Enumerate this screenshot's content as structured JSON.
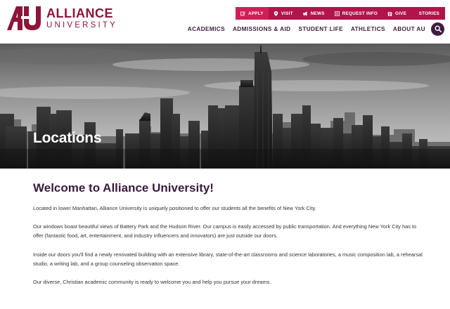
{
  "logo": {
    "mark": "AU",
    "line1": "ALLIANCE",
    "line2": "UNIVERSITY"
  },
  "utility_nav": [
    {
      "label": "APPLY",
      "icon": "pencil-icon"
    },
    {
      "label": "VISIT",
      "icon": "map-pin-icon"
    },
    {
      "label": "NEWS",
      "icon": "megaphone-icon"
    },
    {
      "label": "REQUEST INFO",
      "icon": "info-icon"
    },
    {
      "label": "GIVE",
      "icon": "gift-icon"
    },
    {
      "label": "STORIES",
      "icon": ""
    }
  ],
  "main_nav": [
    "ACADEMICS",
    "ADMISSIONS & AID",
    "STUDENT LIFE",
    "ATHLETICS",
    "ABOUT AU"
  ],
  "search": {
    "icon": "search-icon"
  },
  "hero": {
    "title": "Locations"
  },
  "content": {
    "heading": "Welcome to Alliance University!",
    "paragraphs": [
      "Located in lower Manhattan, Alliance University is uniquely positioned to offer our students all the benefits of New York City.",
      "Our windows boast beautiful views of Battery Park and the Hudson River. Our campus is easily accessed by public transportation. And everything New York City has to offer (fantastic food, art, entertainment, and industry influencers and innovators) are just outside our doors.",
      "Inside our doors you'll find a newly renovated building with an extensive library, state-of-the-art classrooms and science laboratories, a music composition lab, a rehearsal studio, a writing lab, and a group counseling observation space.",
      "Our diverse, Christian academic community is ready to welcome you and help you pursue your dreams."
    ]
  },
  "colors": {
    "brand_crimson": "#8c1538",
    "utility_bar": "#b0154a",
    "utility_active": "#d01e56",
    "nav_text": "#3d2038",
    "heading": "#3a1a40"
  }
}
